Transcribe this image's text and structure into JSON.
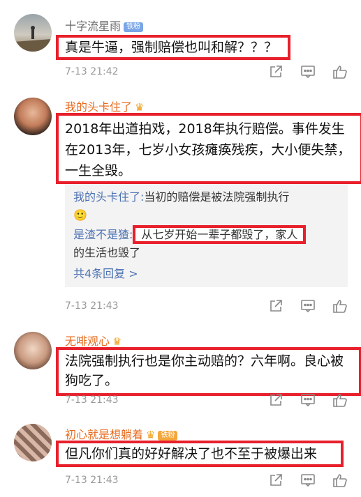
{
  "comments": [
    {
      "username": "十字流星雨",
      "badge": "铁粉",
      "text": "真是牛逼，强制赔偿也叫和解？？？",
      "time": "7-13 21:42"
    },
    {
      "username": "我的头卡住了",
      "text": "2018年出道拍戏，2018年执行赔偿。事件发生在2013年，七岁小女孩瘫痪残疾，大小便失禁，一生全毁。",
      "time": "7-13 21:43",
      "replies": [
        {
          "name": "我的头卡住了:",
          "text": "当初的赔偿是被法院强制执行",
          "emoji": "🙂"
        },
        {
          "name": "是渣不是猹:",
          "text_hl": "从七岁开始一辈子都毁了，家人",
          "text_rest": "的生活也毁了"
        }
      ],
      "more": "共4条回复 >"
    },
    {
      "username": "无啡观心",
      "text": "法院强制执行也是你主动赔的？六年啊。良心被狗吃了。",
      "time": "7-13 21:43"
    },
    {
      "username": "初心就是想躺着",
      "badge": "铁粉",
      "text": "但凡你们真的好好解决了也不至于被爆出来",
      "time": "7-13 21:43"
    }
  ],
  "colors": {
    "highlight": "#e8202c",
    "orange_name": "#e86b1f",
    "link": "#4d72b2"
  },
  "icons": [
    "share-icon",
    "comment-icon",
    "like-icon"
  ]
}
